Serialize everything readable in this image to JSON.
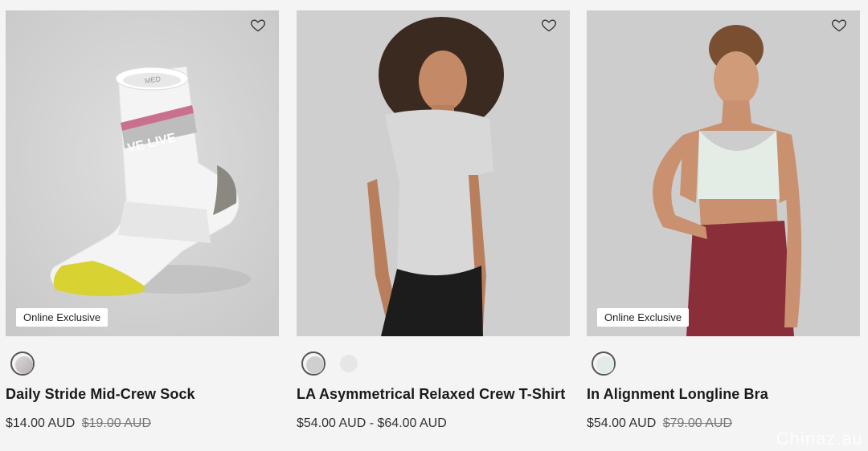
{
  "products": [
    {
      "name": "Daily Stride Mid-Crew Sock",
      "price": "$14.00 AUD",
      "original_price": "$19.00 AUD",
      "badge": "Online Exclusive",
      "sock_text": "VE LIVE",
      "sock_tag": "MED",
      "swatches": [
        {
          "color": "#c8c8c8",
          "selected": true
        }
      ]
    },
    {
      "name": "LA Asymmetrical Relaxed Crew T-Shirt",
      "price": "$54.00 AUD - $64.00 AUD",
      "original_price": "",
      "badge": "",
      "swatches": [
        {
          "color": "#cfcfcf",
          "selected": true
        },
        {
          "color": "#e6e6e6",
          "selected": false
        }
      ]
    },
    {
      "name": "In Alignment Longline Bra",
      "price": "$54.00 AUD",
      "original_price": "$79.00 AUD",
      "badge": "Online Exclusive",
      "swatches": [
        {
          "color": "#e3ebe6",
          "selected": true
        }
      ]
    }
  ],
  "watermark": "Chinaz.au",
  "icons": {
    "wishlist": "heart-outline-icon"
  },
  "colors": {
    "image_bg": "#d3d3d3",
    "page_bg": "#f4f4f4"
  }
}
